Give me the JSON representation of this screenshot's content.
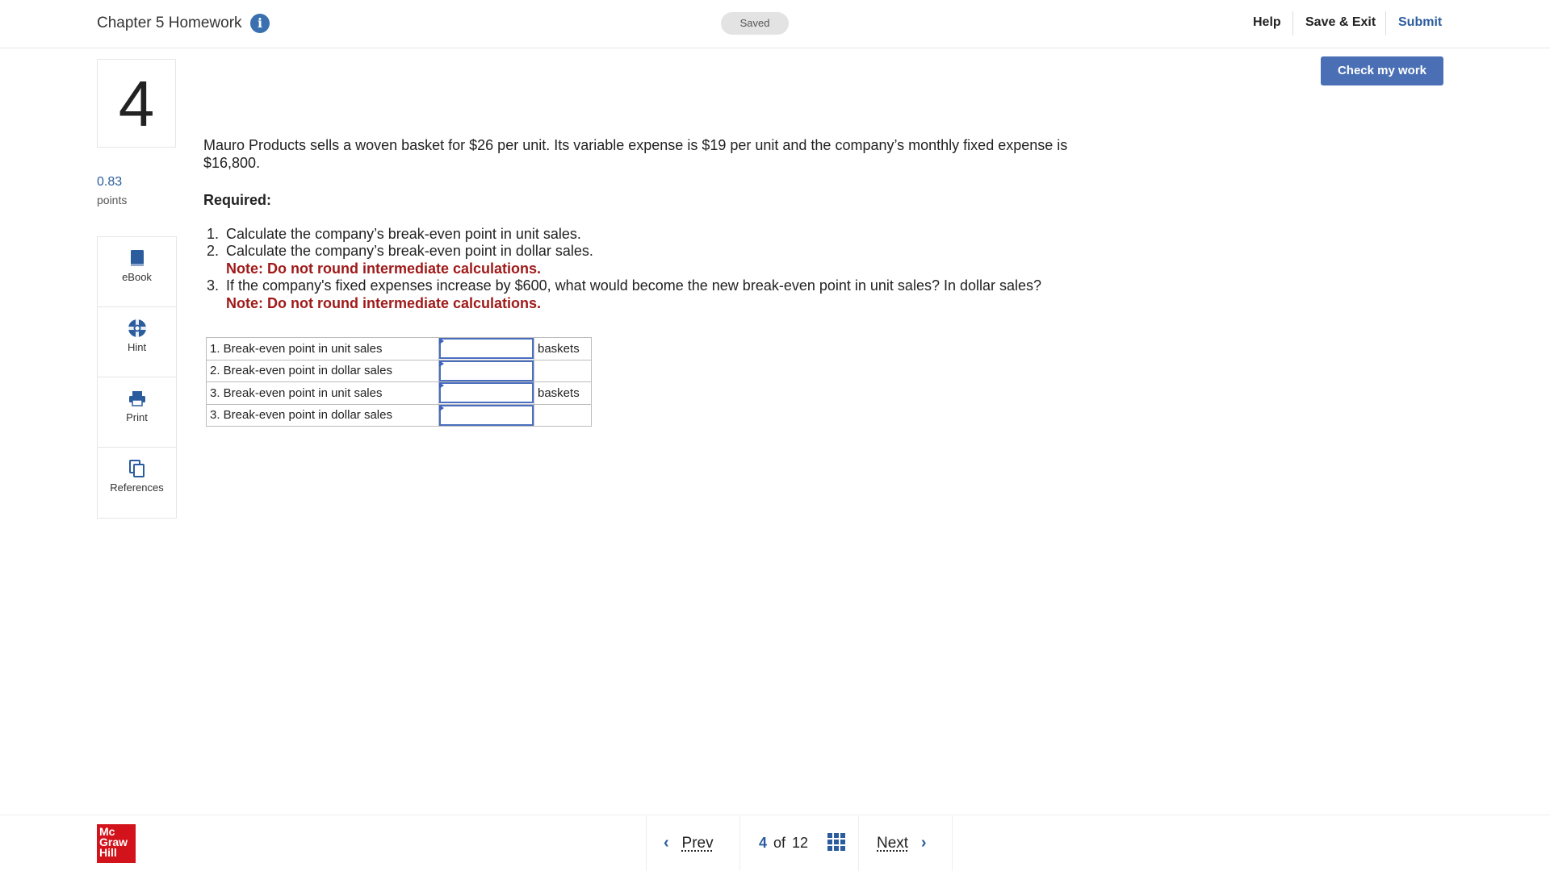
{
  "header": {
    "title": "Chapter 5 Homework",
    "status": "Saved",
    "links": {
      "help": "Help",
      "save_exit": "Save & Exit",
      "submit": "Submit"
    }
  },
  "question": {
    "number": "4",
    "points_value": "0.83",
    "points_label": "points",
    "prompt": "Mauro Products sells a woven basket for $26 per unit. Its variable expense is $19 per unit and the company’s monthly fixed expense is $16,800.",
    "required_label": "Required:",
    "requirements": [
      {
        "num": "1.",
        "text": "Calculate the company’s break-even point in unit sales."
      },
      {
        "num": "2.",
        "text": "Calculate the company’s break-even point in dollar sales.",
        "note": "Note: Do not round intermediate calculations."
      },
      {
        "num": "3.",
        "text": "If the company's fixed expenses increase by $600, what would become the new break-even point in unit sales? In dollar sales?",
        "note": "Note: Do not round intermediate calculations."
      }
    ],
    "answer_rows": [
      {
        "label": "1. Break-even point in unit sales",
        "value": "",
        "unit": "baskets"
      },
      {
        "label": "2. Break-even point in dollar sales",
        "value": "",
        "unit": ""
      },
      {
        "label": "3. Break-even point in unit sales",
        "value": "",
        "unit": "baskets"
      },
      {
        "label": "3. Break-even point in dollar sales",
        "value": "",
        "unit": ""
      }
    ]
  },
  "tools": {
    "ebook": "eBook",
    "hint": "Hint",
    "print": "Print",
    "references": "References"
  },
  "actions": {
    "check_my_work": "Check my work"
  },
  "footer": {
    "logo": [
      "Mc",
      "Graw",
      "Hill"
    ],
    "prev": "Prev",
    "next": "Next",
    "current_page": "4",
    "of": "of",
    "total_pages": "12"
  },
  "colors": {
    "accent": "#2b5d9e",
    "note": "#a01a1a",
    "button": "#4a6fb5",
    "logo": "#d2131b"
  }
}
